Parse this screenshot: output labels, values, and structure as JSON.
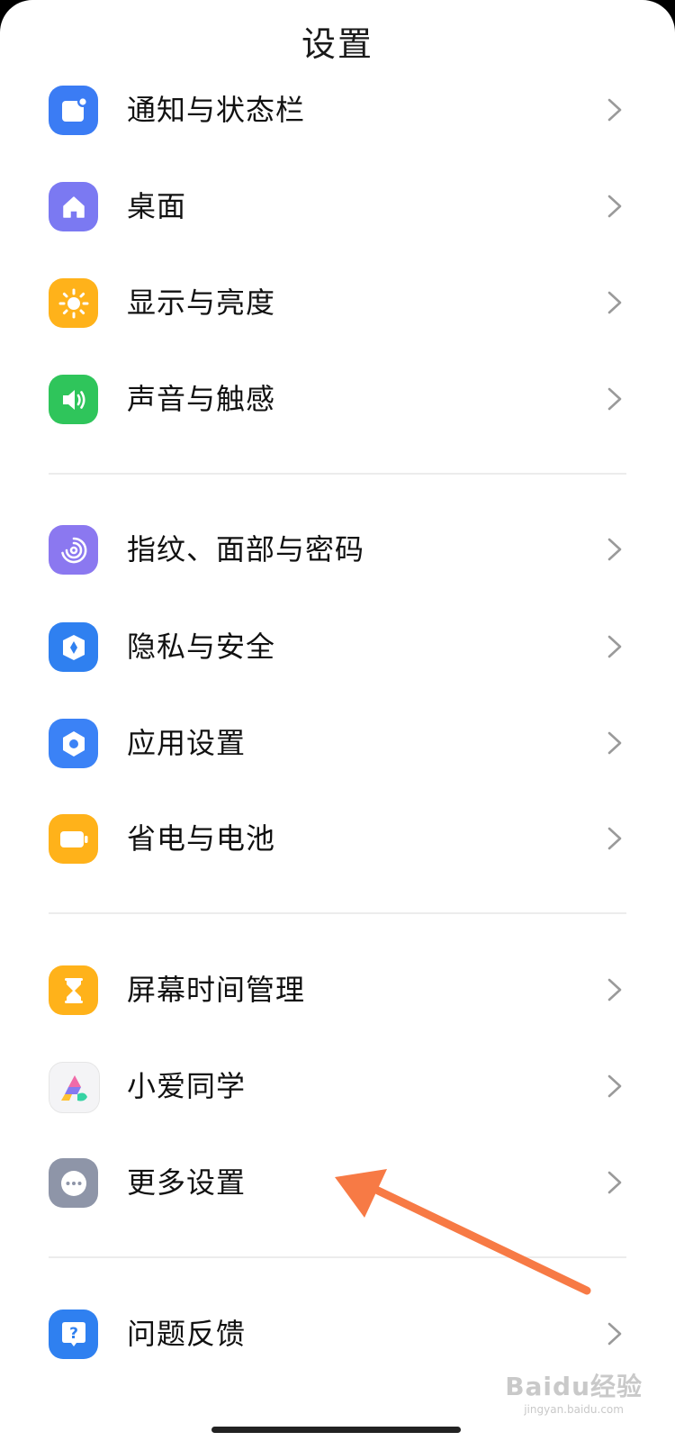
{
  "header": {
    "title": "设置"
  },
  "colors": {
    "notification": "#3b7cf4",
    "desktop": "#7b79f2",
    "display": "#ffb21a",
    "sound": "#2fc55b",
    "fingerprint": "#8b78f0",
    "privacy": "#2f80f0",
    "apps": "#3b82f6",
    "battery": "#ffb21a",
    "screentime": "#ffb21a",
    "feedback": "#2f80f0",
    "more": "#8e95a8",
    "annotation_arrow": "#f77a45"
  },
  "groups": [
    {
      "items": [
        {
          "label": "通知与状态栏",
          "icon": "notification-icon"
        },
        {
          "label": "桌面",
          "icon": "home-icon"
        },
        {
          "label": "显示与亮度",
          "icon": "sun-icon"
        },
        {
          "label": "声音与触感",
          "icon": "speaker-icon"
        }
      ]
    },
    {
      "items": [
        {
          "label": "指纹、面部与密码",
          "icon": "fingerprint-icon"
        },
        {
          "label": "隐私与安全",
          "icon": "shield-icon"
        },
        {
          "label": "应用设置",
          "icon": "hexagon-icon"
        },
        {
          "label": "省电与电池",
          "icon": "battery-icon"
        }
      ]
    },
    {
      "items": [
        {
          "label": "屏幕时间管理",
          "icon": "hourglass-icon"
        },
        {
          "label": "小爱同学",
          "icon": "xiaoai-icon"
        },
        {
          "label": "更多设置",
          "icon": "more-icon"
        }
      ]
    },
    {
      "items": [
        {
          "label": "问题反馈",
          "icon": "feedback-icon"
        }
      ]
    }
  ],
  "watermark": {
    "main": "Baidu经验",
    "sub": "jingyan.baidu.com"
  }
}
